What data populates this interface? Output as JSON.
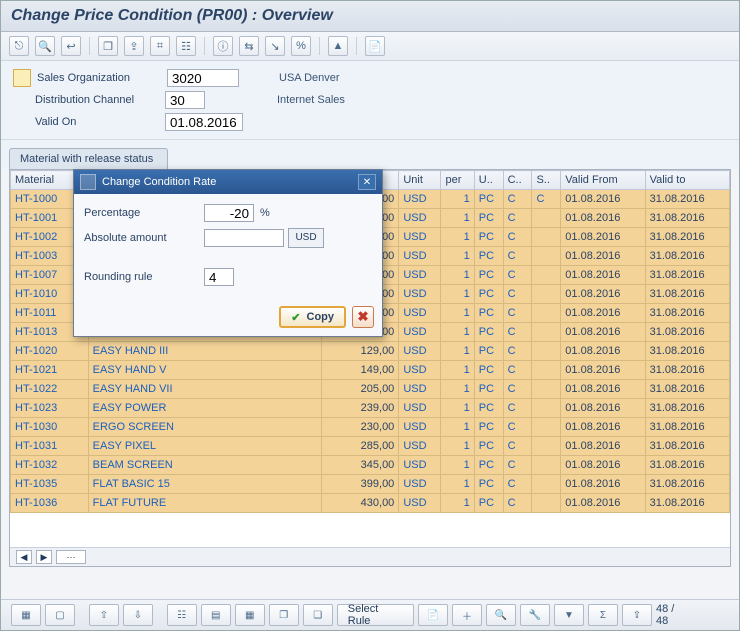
{
  "title": "Change Price Condition (PR00) : Overview",
  "toolbar_icons": [
    "⎋",
    "🔍",
    "↩",
    "❐",
    "⇪",
    "⌗",
    "☷",
    "ⓘ",
    "⇆",
    "↘",
    "%",
    "▲",
    "📄"
  ],
  "selection": {
    "sales_org_label": "Sales Organization",
    "sales_org_value": "3020",
    "sales_org_desc": "USA Denver",
    "dist_ch_label": "Distribution Channel",
    "dist_ch_value": "30",
    "dist_ch_desc": "Internet Sales",
    "valid_on_label": "Valid On",
    "valid_on_value": "01.08.2016"
  },
  "tab_label": "Material with release status",
  "columns": [
    "Material",
    "Description",
    "Amount",
    "Unit",
    "per",
    "U..",
    "C..",
    "S..",
    "Valid From",
    "Valid to"
  ],
  "rows": [
    {
      "mat": "HT-1000",
      "desc": "",
      "amount": "956,00",
      "unit": "USD",
      "per": "1",
      "uom": "PC",
      "c": "C",
      "s": "C",
      "from": "01.08.2016",
      "to": "31.08.2016"
    },
    {
      "mat": "HT-1001",
      "desc": "",
      "amount": "1.249,00",
      "unit": "USD",
      "per": "1",
      "uom": "PC",
      "c": "C",
      "s": "",
      "from": "01.08.2016",
      "to": "31.08.2016"
    },
    {
      "mat": "HT-1002",
      "desc": "",
      "amount": "1.570,00",
      "unit": "USD",
      "per": "1",
      "uom": "PC",
      "c": "C",
      "s": "",
      "from": "01.08.2016",
      "to": "31.08.2016"
    },
    {
      "mat": "HT-1003",
      "desc": "",
      "amount": "1.650,00",
      "unit": "USD",
      "per": "1",
      "uom": "PC",
      "c": "C",
      "s": "",
      "from": "01.08.2016",
      "to": "31.08.2016"
    },
    {
      "mat": "HT-1007",
      "desc": "",
      "amount": "499,00",
      "unit": "USD",
      "per": "1",
      "uom": "PC",
      "c": "C",
      "s": "",
      "from": "01.08.2016",
      "to": "31.08.2016"
    },
    {
      "mat": "HT-1010",
      "desc": "",
      "amount": "1.999,00",
      "unit": "USD",
      "per": "1",
      "uom": "PC",
      "c": "C",
      "s": "",
      "from": "01.08.2016",
      "to": "31.08.2016"
    },
    {
      "mat": "HT-1011",
      "desc": "",
      "amount": "2.299,00",
      "unit": "USD",
      "per": "1",
      "uom": "PC",
      "c": "C",
      "s": "",
      "from": "01.08.2016",
      "to": "31.08.2016"
    },
    {
      "mat": "HT-1013",
      "desc": "",
      "amount": "999,00",
      "unit": "USD",
      "per": "1",
      "uom": "PC",
      "c": "C",
      "s": "",
      "from": "01.08.2016",
      "to": "31.08.2016"
    },
    {
      "mat": "HT-1020",
      "desc": "EASY HAND III",
      "amount": "129,00",
      "unit": "USD",
      "per": "1",
      "uom": "PC",
      "c": "C",
      "s": "",
      "from": "01.08.2016",
      "to": "31.08.2016"
    },
    {
      "mat": "HT-1021",
      "desc": "EASY HAND V",
      "amount": "149,00",
      "unit": "USD",
      "per": "1",
      "uom": "PC",
      "c": "C",
      "s": "",
      "from": "01.08.2016",
      "to": "31.08.2016"
    },
    {
      "mat": "HT-1022",
      "desc": "EASY HAND VII",
      "amount": "205,00",
      "unit": "USD",
      "per": "1",
      "uom": "PC",
      "c": "C",
      "s": "",
      "from": "01.08.2016",
      "to": "31.08.2016"
    },
    {
      "mat": "HT-1023",
      "desc": "EASY POWER",
      "amount": "239,00",
      "unit": "USD",
      "per": "1",
      "uom": "PC",
      "c": "C",
      "s": "",
      "from": "01.08.2016",
      "to": "31.08.2016"
    },
    {
      "mat": "HT-1030",
      "desc": "ERGO SCREEN",
      "amount": "230,00",
      "unit": "USD",
      "per": "1",
      "uom": "PC",
      "c": "C",
      "s": "",
      "from": "01.08.2016",
      "to": "31.08.2016"
    },
    {
      "mat": "HT-1031",
      "desc": "EASY PIXEL",
      "amount": "285,00",
      "unit": "USD",
      "per": "1",
      "uom": "PC",
      "c": "C",
      "s": "",
      "from": "01.08.2016",
      "to": "31.08.2016"
    },
    {
      "mat": "HT-1032",
      "desc": "BEAM SCREEN",
      "amount": "345,00",
      "unit": "USD",
      "per": "1",
      "uom": "PC",
      "c": "C",
      "s": "",
      "from": "01.08.2016",
      "to": "31.08.2016"
    },
    {
      "mat": "HT-1035",
      "desc": "FLAT BASIC 15",
      "amount": "399,00",
      "unit": "USD",
      "per": "1",
      "uom": "PC",
      "c": "C",
      "s": "",
      "from": "01.08.2016",
      "to": "31.08.2016"
    },
    {
      "mat": "HT-1036",
      "desc": "FLAT FUTURE",
      "amount": "430,00",
      "unit": "USD",
      "per": "1",
      "uom": "PC",
      "c": "C",
      "s": "",
      "from": "01.08.2016",
      "to": "31.08.2016"
    }
  ],
  "dialog": {
    "title": "Change Condition Rate",
    "percentage_label": "Percentage",
    "percentage_value": "-20",
    "percentage_unit": "%",
    "absolute_label": "Absolute amount",
    "absolute_value": "",
    "absolute_curr": "USD",
    "rounding_label": "Rounding rule",
    "rounding_value": "4",
    "copy_label": "Copy"
  },
  "bottom": {
    "select_rule_label": "Select Rule",
    "record_count": "48  /  48"
  }
}
